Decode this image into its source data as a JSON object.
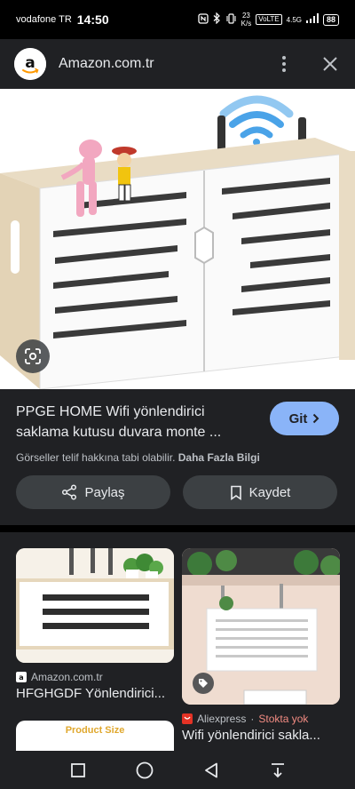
{
  "status_bar": {
    "carrier": "vodafone TR",
    "time": "14:50",
    "speed_value": "23",
    "speed_unit": "K/s",
    "volte": "VoLTE",
    "network": "4.5G",
    "battery": "88"
  },
  "header": {
    "site": "Amazon.com.tr",
    "logo_letter": "a"
  },
  "product": {
    "title": "PPGE HOME Wifi yönlendirici saklama kutusu duvara monte ...",
    "go_label": "Git",
    "copyright_text": "Görseller telif hakkına tabi olabilir.",
    "learn_more": "Daha Fazla Bilgi",
    "share_label": "Paylaş",
    "save_label": "Kaydet"
  },
  "related": [
    {
      "source": "Amazon.com.tr",
      "title": "HFGHGDF Yönlendirici..."
    },
    {
      "source": "Aliexpress",
      "separator": "·",
      "stock": "Stokta yok",
      "title": "Wifi yönlendirici sakla..."
    },
    {
      "overlay_text": "Product Size"
    }
  ],
  "colors": {
    "accent": "#8ab4f8",
    "surface": "#202124",
    "button": "#3c4043",
    "out_of_stock": "#f28b82",
    "aliexpress": "#e43225"
  }
}
